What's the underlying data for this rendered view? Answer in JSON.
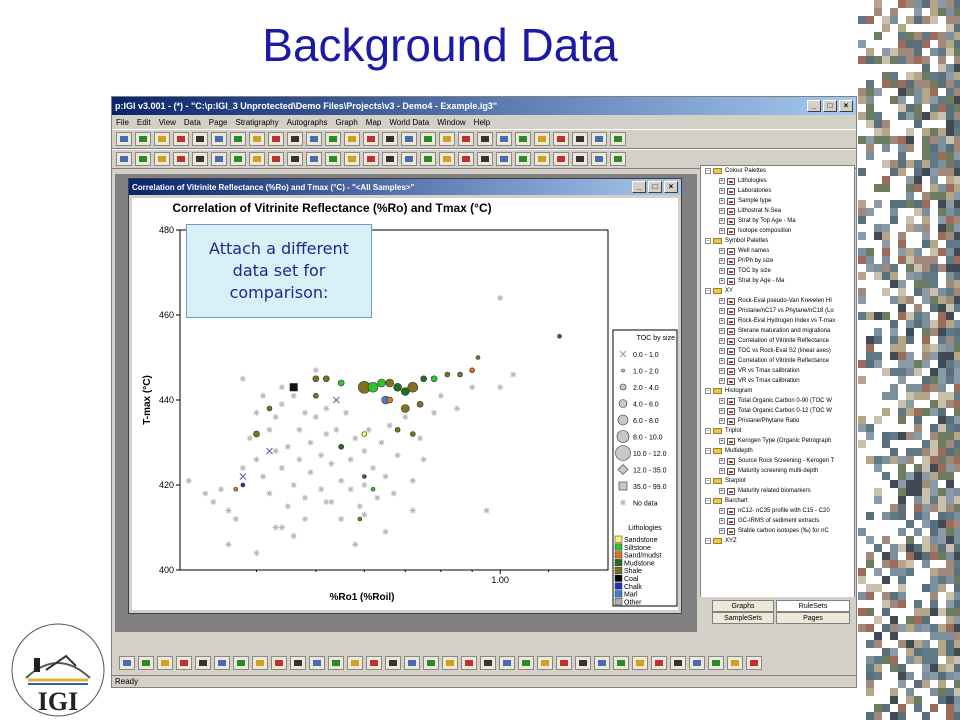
{
  "slide": {
    "title": "Background Data"
  },
  "app": {
    "title": "p:IGI v3.001 - (*) - \"C:\\p:IGI_3 Unprotected\\Demo Files\\Projects\\v3 - Demo4 - Example.ig3\"",
    "menu": [
      "File",
      "Edit",
      "View",
      "Data",
      "Page",
      "Stratigraphy",
      "Autographs",
      "Graph",
      "Map",
      "World Data",
      "Window",
      "Help"
    ],
    "status": "Ready"
  },
  "chart_window": {
    "title": "Correlation of Vitrinite Reflectance (%Ro) and Tmax (°C) - \"<All Samples>\""
  },
  "callout": {
    "text": "Attach a different data set for comparison:"
  },
  "tree": [
    {
      "level": 0,
      "type": "folder",
      "label": "Colour Palettes"
    },
    {
      "level": 1,
      "type": "file",
      "label": "Lithologies"
    },
    {
      "level": 1,
      "type": "file",
      "label": "Laboratories"
    },
    {
      "level": 1,
      "type": "file",
      "label": "Sample type"
    },
    {
      "level": 1,
      "type": "file",
      "label": "Lithostrat N.Sea"
    },
    {
      "level": 1,
      "type": "file",
      "label": "Strat by Top Age - Ma"
    },
    {
      "level": 1,
      "type": "file",
      "label": "Isotope composition"
    },
    {
      "level": 0,
      "type": "folder",
      "label": "Symbol Palettes"
    },
    {
      "level": 1,
      "type": "file",
      "label": "Well names"
    },
    {
      "level": 1,
      "type": "file",
      "label": "Pr/Ph by size"
    },
    {
      "level": 1,
      "type": "file",
      "label": "TOC by size"
    },
    {
      "level": 1,
      "type": "file",
      "label": "Strat by Age - Ma"
    },
    {
      "level": 0,
      "type": "folder",
      "label": "XY"
    },
    {
      "level": 1,
      "type": "file",
      "label": "Rock-Eval pseudo-Van Krevelen HI"
    },
    {
      "level": 1,
      "type": "file",
      "label": "Pristane/nC17 vs Phytane/nC18 (Lo"
    },
    {
      "level": 1,
      "type": "file",
      "label": "Rock-Eval Hydrogen Index vs T-max"
    },
    {
      "level": 1,
      "type": "file",
      "label": "Sterane maturation and migrationa"
    },
    {
      "level": 1,
      "type": "file",
      "label": "Correlation of Vitrinite Reflectance"
    },
    {
      "level": 1,
      "type": "file",
      "label": "TOC vs Rock-Eval S2 (linear axes)"
    },
    {
      "level": 1,
      "type": "file",
      "label": "Correlation of Vitrinite Reflectance"
    },
    {
      "level": 1,
      "type": "file",
      "label": "VR vs Tmax calibration"
    },
    {
      "level": 1,
      "type": "file",
      "label": "VR vs Tmax calibration"
    },
    {
      "level": 0,
      "type": "folder",
      "label": "Histogram"
    },
    {
      "level": 1,
      "type": "file",
      "label": "Total Organic Carbon 0-90 (TOC W"
    },
    {
      "level": 1,
      "type": "file",
      "label": "Total Organic Carbon 0-12 (TOC W"
    },
    {
      "level": 1,
      "type": "file",
      "label": "Pristane/Phytane Ratio"
    },
    {
      "level": 0,
      "type": "folder",
      "label": "Triplot"
    },
    {
      "level": 1,
      "type": "file",
      "label": "Kerogen Type (Organic Petrograph"
    },
    {
      "level": 0,
      "type": "folder",
      "label": "Multidepth"
    },
    {
      "level": 1,
      "type": "file",
      "label": "Source Rock Screening - Kerogen T"
    },
    {
      "level": 1,
      "type": "file",
      "label": "Maturity screening multi-depth"
    },
    {
      "level": 0,
      "type": "folder",
      "label": "Starplot"
    },
    {
      "level": 1,
      "type": "file",
      "label": "Maturity related biomarkers"
    },
    {
      "level": 0,
      "type": "folder",
      "label": "Barchart"
    },
    {
      "level": 1,
      "type": "file",
      "label": "nC12- nC35 profile with C15 - C20"
    },
    {
      "level": 1,
      "type": "file",
      "label": "GC-IRMS of sediment extracts"
    },
    {
      "level": 1,
      "type": "file",
      "label": "Stable carbon isotopes (‰) for nC"
    },
    {
      "level": 0,
      "type": "folder",
      "label": "XYZ"
    }
  ],
  "tabs": {
    "graphs": "Graphs",
    "rulesets": "RuleSets",
    "samplesets": "SampleSets",
    "pages": "Pages"
  },
  "colors": {
    "title_blue": "#1a1aa8",
    "callout_bg": "#d8f0f8"
  },
  "chart_data": {
    "type": "scatter",
    "title": "Correlation of Vitrinite Reflectance (%Ro) and Tmax (°C)",
    "xlabel": "%Ro1 (%Roil)",
    "ylabel": "T-max (°C)",
    "x_scale": "log",
    "xlim": [
      0.3,
      1.5
    ],
    "ylim": [
      400,
      480
    ],
    "y_ticks": [
      400,
      420,
      440,
      460,
      480
    ],
    "x_ticks": [
      1.0
    ],
    "x_tick_labels": [
      "1.00"
    ],
    "legend_toc": {
      "title": "TOC by size",
      "entries": [
        {
          "label": "0.0 - 1.0",
          "symbol": "x"
        },
        {
          "label": "1.0 - 2.0",
          "symbol": "circle",
          "r": 1.5
        },
        {
          "label": "2.0 - 4.0",
          "symbol": "circle",
          "r": 3
        },
        {
          "label": "4.0 - 6.0",
          "symbol": "circle",
          "r": 4
        },
        {
          "label": "6.0 - 8.0",
          "symbol": "circle",
          "r": 5
        },
        {
          "label": "8.0 - 10.0",
          "symbol": "circle",
          "r": 6
        },
        {
          "label": "10.0 - 12.0",
          "symbol": "circle",
          "r": 7.5
        },
        {
          "label": "12.0 - 35.0",
          "symbol": "diamond"
        },
        {
          "label": "35.0 - 99.0",
          "symbol": "square"
        },
        {
          "label": "No data",
          "symbol": "star"
        }
      ]
    },
    "legend_lith": {
      "title": "Lithologies",
      "entries": [
        {
          "label": "Sandstone",
          "color": "#f8f060"
        },
        {
          "label": "Siltstone",
          "color": "#30c030"
        },
        {
          "label": "Sand/mudst",
          "color": "#e07020"
        },
        {
          "label": "Mudstone",
          "color": "#207020"
        },
        {
          "label": "Shale",
          "color": "#807020"
        },
        {
          "label": "Coal",
          "color": "#000000"
        },
        {
          "label": "Chalk",
          "color": "#2030c0"
        },
        {
          "label": "Marl",
          "color": "#4080d0"
        },
        {
          "label": "Other",
          "color": "#b0b0b0"
        }
      ]
    },
    "background_points": [
      [
        0.31,
        421
      ],
      [
        0.33,
        418
      ],
      [
        0.34,
        416
      ],
      [
        0.35,
        419
      ],
      [
        0.36,
        414
      ],
      [
        0.37,
        412
      ],
      [
        0.38,
        424
      ],
      [
        0.39,
        431
      ],
      [
        0.4,
        426
      ],
      [
        0.4,
        437
      ],
      [
        0.41,
        422
      ],
      [
        0.41,
        441
      ],
      [
        0.42,
        418
      ],
      [
        0.42,
        433
      ],
      [
        0.43,
        428
      ],
      [
        0.43,
        436
      ],
      [
        0.44,
        410
      ],
      [
        0.44,
        424
      ],
      [
        0.44,
        439
      ],
      [
        0.45,
        415
      ],
      [
        0.45,
        429
      ],
      [
        0.46,
        441
      ],
      [
        0.46,
        420
      ],
      [
        0.47,
        433
      ],
      [
        0.47,
        426
      ],
      [
        0.48,
        437
      ],
      [
        0.48,
        417
      ],
      [
        0.49,
        430
      ],
      [
        0.49,
        423
      ],
      [
        0.5,
        436
      ],
      [
        0.5,
        441
      ],
      [
        0.51,
        427
      ],
      [
        0.51,
        419
      ],
      [
        0.52,
        432
      ],
      [
        0.52,
        438
      ],
      [
        0.53,
        425
      ],
      [
        0.53,
        416
      ],
      [
        0.54,
        433
      ],
      [
        0.55,
        429
      ],
      [
        0.55,
        421
      ],
      [
        0.56,
        437
      ],
      [
        0.57,
        426
      ],
      [
        0.57,
        419
      ],
      [
        0.58,
        431
      ],
      [
        0.59,
        415
      ],
      [
        0.6,
        428
      ],
      [
        0.6,
        420
      ],
      [
        0.61,
        433
      ],
      [
        0.62,
        424
      ],
      [
        0.63,
        417
      ],
      [
        0.64,
        430
      ],
      [
        0.65,
        422
      ],
      [
        0.66,
        434
      ],
      [
        0.67,
        418
      ],
      [
        0.68,
        427
      ],
      [
        0.7,
        436
      ],
      [
        0.72,
        421
      ],
      [
        0.74,
        431
      ],
      [
        0.75,
        426
      ],
      [
        0.78,
        437
      ],
      [
        0.8,
        441
      ],
      [
        0.85,
        438
      ],
      [
        0.9,
        443
      ],
      [
        1.0,
        443
      ],
      [
        1.05,
        446
      ],
      [
        0.95,
        414
      ],
      [
        0.72,
        414
      ],
      [
        0.5,
        447
      ],
      [
        0.38,
        445
      ],
      [
        0.43,
        410
      ],
      [
        0.46,
        408
      ],
      [
        0.55,
        412
      ],
      [
        0.65,
        409
      ],
      [
        0.36,
        406
      ],
      [
        0.4,
        404
      ],
      [
        0.48,
        412
      ],
      [
        0.58,
        406
      ],
      [
        0.44,
        443
      ],
      [
        0.52,
        416
      ],
      [
        0.6,
        413
      ],
      [
        1.0,
        464
      ]
    ],
    "colored_points": [
      [
        0.6,
        443,
        "#807020",
        6
      ],
      [
        0.62,
        443,
        "#30c030",
        5
      ],
      [
        0.64,
        444,
        "#30c030",
        4
      ],
      [
        0.66,
        444,
        "#807020",
        4
      ],
      [
        0.68,
        443,
        "#207020",
        4
      ],
      [
        0.7,
        442,
        "#207020",
        4
      ],
      [
        0.72,
        443,
        "#807020",
        5
      ],
      [
        0.75,
        445,
        "#207020",
        3
      ],
      [
        0.78,
        445,
        "#30c030",
        3
      ],
      [
        0.82,
        446,
        "#807020",
        2.5
      ],
      [
        0.86,
        446,
        "#807020",
        2.5
      ],
      [
        0.9,
        447,
        "#e07020",
        2.5
      ],
      [
        0.65,
        440,
        "#4080d0",
        4
      ],
      [
        0.66,
        440,
        "#e07020",
        3
      ],
      [
        0.7,
        438,
        "#807020",
        4
      ],
      [
        0.74,
        439,
        "#807020",
        3
      ],
      [
        0.5,
        445,
        "#807020",
        3
      ],
      [
        0.52,
        445,
        "#807020",
        3
      ],
      [
        0.55,
        444,
        "#30c030",
        3
      ],
      [
        0.42,
        438,
        "#807020",
        2.5
      ],
      [
        0.4,
        432,
        "#807020",
        3
      ],
      [
        0.55,
        429,
        "#207020",
        2.5
      ],
      [
        0.6,
        432,
        "#f8f060",
        2.5
      ],
      [
        0.68,
        433,
        "#807020",
        2.5
      ],
      [
        0.72,
        432,
        "#807020",
        2.5
      ],
      [
        0.5,
        441,
        "#807020",
        2.5
      ],
      [
        0.38,
        420,
        "#2030c0",
        2
      ],
      [
        0.37,
        419,
        "#e07020",
        2
      ],
      [
        1.25,
        455,
        "#207020",
        2
      ],
      [
        0.92,
        450,
        "#807020",
        2
      ],
      [
        0.6,
        422,
        "#207020",
        2
      ],
      [
        0.62,
        419,
        "#30c030",
        2
      ],
      [
        0.59,
        412,
        "#807020",
        2
      ]
    ],
    "square_points": [
      [
        0.46,
        443,
        "#111111"
      ]
    ],
    "x_points": [
      [
        0.38,
        422
      ],
      [
        0.42,
        428
      ],
      [
        0.54,
        440
      ]
    ]
  }
}
